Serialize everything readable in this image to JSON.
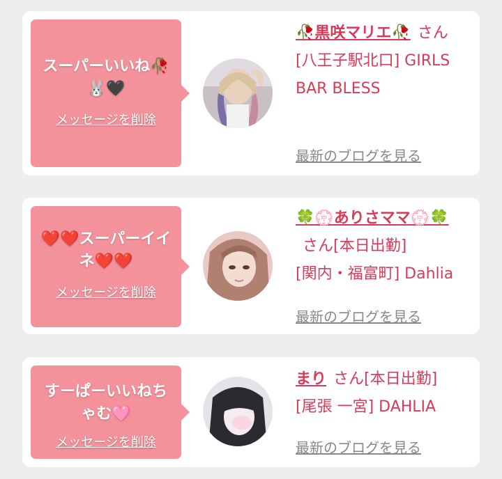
{
  "entries": [
    {
      "message": "スーパーいいね🥀🐰🖤",
      "delete_label": "メッセージを削除",
      "name": "🥀黒咲マリエ🥀",
      "honorific": "さん",
      "status": "",
      "shop": "[八王子駅北口] GIRLS BAR BLESS",
      "blog_label": "最新のブログを見る",
      "avatar_icon": "profile-photo"
    },
    {
      "message": "❤️❤️スーパーイイネ❤️❤️",
      "delete_label": "メッセージを削除",
      "name": "🍀💮ありさママ💮🍀",
      "honorific": "さん",
      "status": "[本日出勤]",
      "shop": "[関内・福富町] Dahlia",
      "blog_label": "最新のブログを見る",
      "avatar_icon": "profile-photo"
    },
    {
      "message": "すーぱーいいねちゃむ🩷",
      "delete_label": "メッセージを削除",
      "name": "まり",
      "honorific": "さん",
      "status": "[本日出勤]",
      "shop": "[尾張 一宮] DAHLIA",
      "blog_label": "最新のブログを見る",
      "avatar_icon": "profile-photo"
    }
  ],
  "colors": {
    "bubble": "#f4929c",
    "name": "#d83a5a",
    "link": "#888888",
    "background": "#eeeeee"
  }
}
